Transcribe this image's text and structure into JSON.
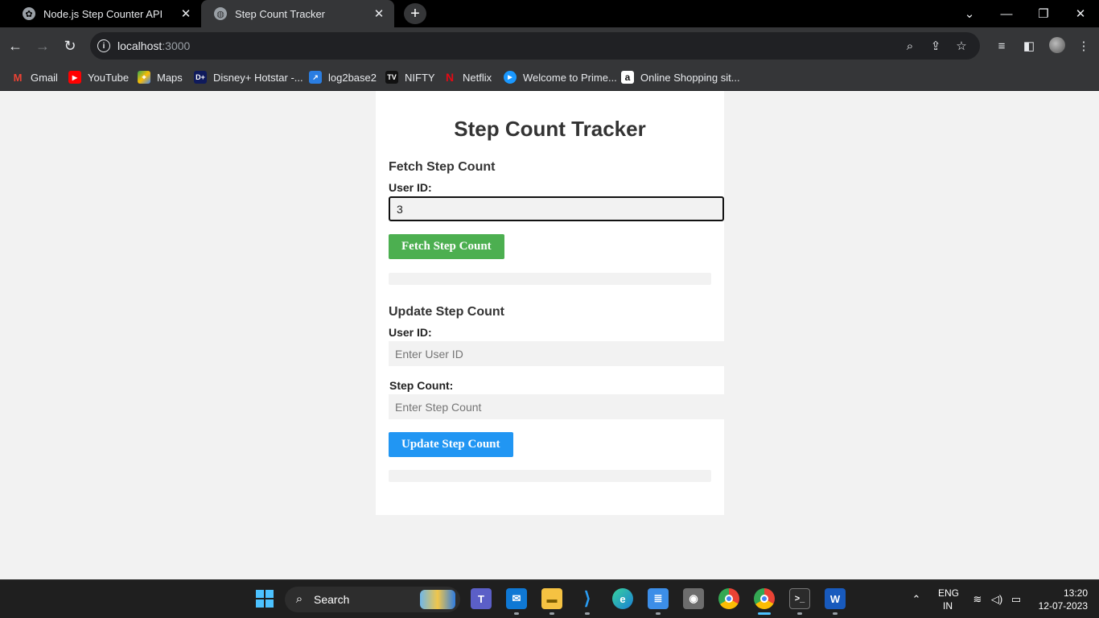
{
  "browser": {
    "tabs": [
      {
        "title": "Node.js Step Counter API",
        "icon": "chatgpt-icon"
      },
      {
        "title": "Step Count Tracker",
        "icon": "globe-icon"
      }
    ],
    "new_tab_label": "+",
    "address": {
      "host": "localhost",
      "port": ":3000"
    },
    "bookmarks": [
      {
        "label": "Gmail",
        "icon": "gmail-icon",
        "color": "#ea4335"
      },
      {
        "label": "YouTube",
        "icon": "youtube-icon",
        "color": "#ff0000"
      },
      {
        "label": "Maps",
        "icon": "maps-icon",
        "color": "#34a853"
      },
      {
        "label": "Disney+ Hotstar -...",
        "icon": "hotstar-icon",
        "color": "#0f1a5c"
      },
      {
        "label": "log2base2",
        "icon": "log2base2-icon",
        "color": "#2a7de1"
      },
      {
        "label": "NIFTY",
        "icon": "tradingview-icon",
        "color": "#111111"
      },
      {
        "label": "Netflix",
        "icon": "netflix-icon",
        "color": "#e50914"
      },
      {
        "label": "Welcome to Prime...",
        "icon": "prime-video-icon",
        "color": "#1a98ff"
      },
      {
        "label": "Online Shopping sit...",
        "icon": "amazon-icon",
        "color": "#ffffff"
      }
    ],
    "bookmark_glyphs": {
      "hotstar": "D+",
      "netflix": "N",
      "nifty": "TV",
      "amazon": "a"
    }
  },
  "page": {
    "title": "Step Count Tracker",
    "fetch": {
      "heading": "Fetch Step Count",
      "user_id_label": "User ID:",
      "user_id_value": "3",
      "button_label": "Fetch Step Count",
      "result": ""
    },
    "update": {
      "heading": "Update Step Count",
      "user_id_label": "User ID:",
      "user_id_placeholder": "Enter User ID",
      "step_count_label": "Step Count:",
      "step_count_placeholder": "Enter Step Count",
      "button_label": "Update Step Count",
      "result": ""
    },
    "colors": {
      "fetch_button": "#4caf50",
      "update_button": "#2196f3"
    }
  },
  "taskbar": {
    "search_label": "Search",
    "apps": [
      "windows-start-icon",
      "teams-icon",
      "mail-icon",
      "file-explorer-icon",
      "vscode-icon",
      "edge-icon",
      "notepad-icon",
      "camera-icon",
      "chrome-icon",
      "chrome-profile-icon",
      "terminal-icon",
      "word-icon"
    ],
    "language": {
      "line1": "ENG",
      "line2": "IN"
    },
    "clock": {
      "time": "13:20",
      "date": "12-07-2023"
    }
  }
}
